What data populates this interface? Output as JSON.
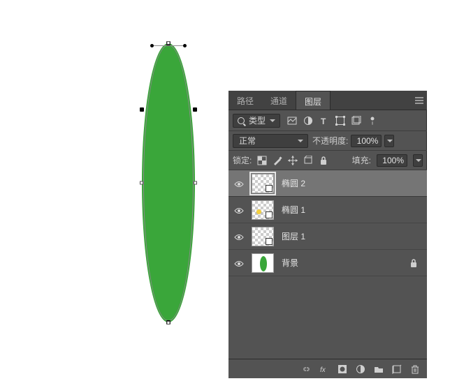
{
  "tabs": {
    "paths": "路径",
    "channels": "通道",
    "layers": "图层"
  },
  "filter_row": {
    "kind_label": "类型"
  },
  "blend_row": {
    "mode": "正常",
    "opacity_label": "不透明度:",
    "opacity_value": "100%"
  },
  "lock_row": {
    "label": "锁定:",
    "fill_label": "填充:",
    "fill_value": "100%"
  },
  "layers": [
    {
      "name": "椭圆 2"
    },
    {
      "name": "椭圆 1"
    },
    {
      "name": "图层 1"
    },
    {
      "name": "背景"
    }
  ]
}
